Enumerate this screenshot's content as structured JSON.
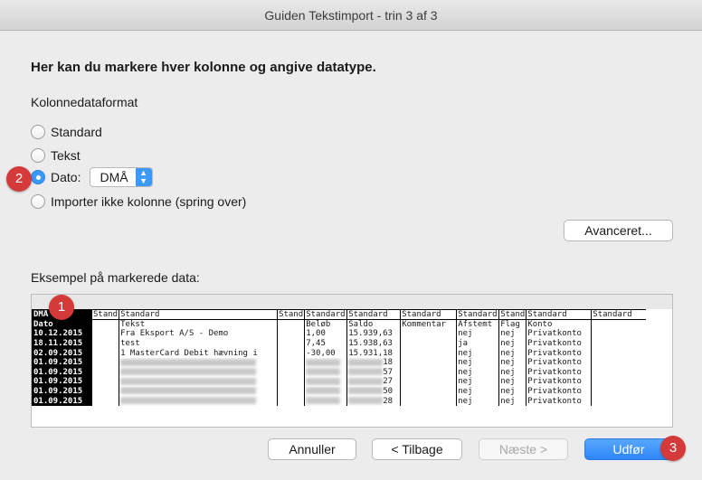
{
  "window": {
    "title": "Guiden Tekstimport - trin 3 af 3"
  },
  "heading": "Her kan du markere hver kolonne og angive datatype.",
  "format_section": {
    "label": "Kolonnedataformat",
    "options": [
      {
        "label": "Standard",
        "checked": false
      },
      {
        "label": "Tekst",
        "checked": false
      },
      {
        "label": "Dato:",
        "checked": true
      },
      {
        "label": "Importer ikke kolonne (spring over)",
        "checked": false
      }
    ],
    "date_select": {
      "value": "DMÅ"
    }
  },
  "advanced_button": "Avanceret...",
  "preview": {
    "label": "Eksempel på markerede data:",
    "header": [
      "DMÅ",
      "Stand",
      "Standard",
      "Stand",
      "Standard",
      "Standard",
      "Standard",
      "Standard",
      "Stand",
      "Standard",
      "Standard"
    ],
    "rows": [
      [
        "Dato",
        "",
        "Tekst",
        "",
        "Beløb",
        "Saldo",
        "Kommentar",
        "Afstemt",
        "Flag",
        "Konto",
        ""
      ],
      [
        "10.12.2015",
        "",
        "Fra Eksport A/S - Demo",
        "",
        "1,00",
        "15.939,63",
        "",
        "nej",
        "nej",
        "Privatkonto",
        ""
      ],
      [
        "18.11.2015",
        "",
        "test",
        "",
        "7,45",
        "15.938,63",
        "",
        "ja",
        "nej",
        "Privatkonto",
        ""
      ],
      [
        "02.09.2015",
        "",
        "1 MasterCard Debit hævning i",
        "",
        "-30,00",
        "15.931,18",
        "",
        "nej",
        "nej",
        "Privatkonto",
        ""
      ],
      [
        "01.09.2015",
        "",
        "",
        "",
        "",
        "18",
        "",
        "nej",
        "nej",
        "Privatkonto",
        ""
      ],
      [
        "01.09.2015",
        "",
        "",
        "",
        "",
        "57",
        "",
        "nej",
        "nej",
        "Privatkonto",
        ""
      ],
      [
        "01.09.2015",
        "",
        "",
        "",
        "",
        "27",
        "",
        "nej",
        "nej",
        "Privatkonto",
        ""
      ],
      [
        "01.09.2015",
        "",
        "",
        "",
        "",
        "50",
        "",
        "nej",
        "nej",
        "Privatkonto",
        ""
      ],
      [
        "01.09.2015",
        "",
        "",
        "",
        "",
        "28",
        "",
        "nej",
        "nej",
        "Privatkonto",
        ""
      ]
    ]
  },
  "buttons": {
    "cancel": "Annuller",
    "back": "< Tilbage",
    "next": "Næste >",
    "finish": "Udfør"
  },
  "badges": [
    "1",
    "2",
    "3"
  ],
  "colors": {
    "accent": "#3b99fc",
    "badge": "#d43a3a"
  }
}
